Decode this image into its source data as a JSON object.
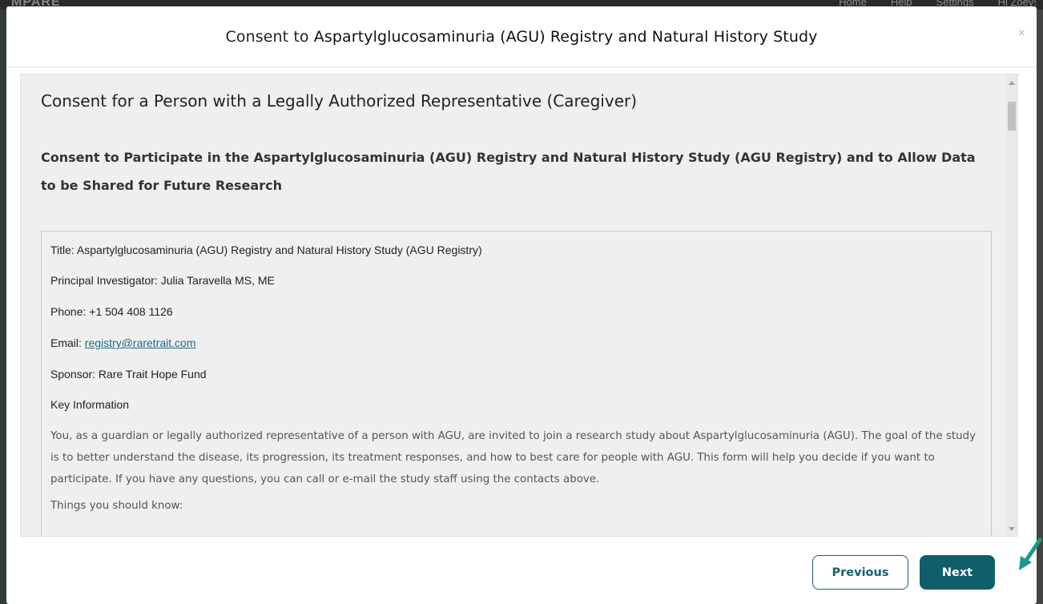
{
  "background": {
    "logo_text": "MPARE",
    "nav": [
      "Home",
      "Help",
      "Settings",
      "Hi Zoey!"
    ]
  },
  "modal": {
    "title_prefix": "Consent to ",
    "title_study": "Aspartylglucosaminuria (AGU) Registry and Natural History Study",
    "close_glyph": "×"
  },
  "content": {
    "heading": "Consent for a Person with a Legally Authorized Representative (Caregiver)",
    "subheading": "Consent to Participate in the Aspartylglucosaminuria (AGU) Registry and Natural History Study (AGU Registry) and to Allow Data to be Shared for Future Research",
    "document": {
      "title": "Title: Aspartylglucosaminuria (AGU) Registry and Natural History Study (AGU Registry)",
      "pi": "Principal Investigator: Julia Taravella MS, ME",
      "phone": "Phone: +1 504 408 1126",
      "email_label": "Email: ",
      "email_link": "registry@raretrait.com",
      "sponsor": "Sponsor: Rare Trait Hope Fund",
      "key_info_heading": "Key Information",
      "key_info_paragraph": "You, as a guardian or legally authorized representative of a person with AGU, are invited to join a research study about Aspartylglucosaminuria (AGU). The goal of the study is to better understand the disease, its progression, its treatment responses, and how to best care for people with AGU. This form will help you decide if you want to participate. If you have any questions, you can call or e-mail the study staff using the contacts above.",
      "things_to_know": "Things you should know:"
    }
  },
  "footer": {
    "previous_label": "Previous",
    "next_label": "Next"
  },
  "colors": {
    "primary": "#0f5e6b",
    "link": "#1e6a8a",
    "pointer": "#1a9a8a"
  }
}
